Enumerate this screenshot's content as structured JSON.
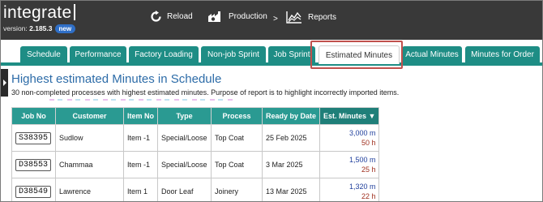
{
  "app": {
    "logo": "integrate",
    "version_label": "version: ",
    "version": "2.185.3",
    "new_badge": "new"
  },
  "nav": {
    "reload": "Reload",
    "production": "Production",
    "arrow": ">",
    "reports": "Reports"
  },
  "tabs": [
    {
      "label": "Schedule"
    },
    {
      "label": "Performance"
    },
    {
      "label": "Factory Loading"
    },
    {
      "label": "Non-job Sprint"
    },
    {
      "label": "Job Sprint"
    },
    {
      "label": "Estimated Minutes",
      "active": true
    },
    {
      "label": "Actual Minutes"
    },
    {
      "label": "Minutes for Order"
    }
  ],
  "report": {
    "title": "Highest estimated Minutes in Schedule",
    "subtitle": "30 non-completed processes with highest estimated minutes. Purpose of report is to highlight incorrectly imported items.",
    "columns": [
      "Job No",
      "Customer",
      "Item No",
      "Type",
      "Process",
      "Ready by Date",
      "Est. Minutes ▼"
    ],
    "rows": [
      {
        "job": "S38395",
        "customer": "Sudlow",
        "item": "Item -1",
        "type": "Special/Loose",
        "process": "Top Coat",
        "date": "25 Feb 2025",
        "mins": "3,000 m",
        "hours": "50 h"
      },
      {
        "job": "D38553",
        "customer": "Chammaa",
        "item": "Item -1",
        "type": "Special/Loose",
        "process": "Top Coat",
        "date": "3 Mar 2025",
        "mins": "1,500 m",
        "hours": "25 h"
      },
      {
        "job": "D38549",
        "customer": "Lawrence",
        "item": "Item 1",
        "type": "Door Leaf",
        "process": "Joinery",
        "date": "13 Mar 2025",
        "mins": "1,320 m",
        "hours": "22 h"
      }
    ]
  },
  "colors": {
    "topbar": "#393939",
    "tab": "#1e8d85",
    "header": "#2a9a92",
    "title": "#2d6ca8",
    "highlight": "#c0504d"
  }
}
